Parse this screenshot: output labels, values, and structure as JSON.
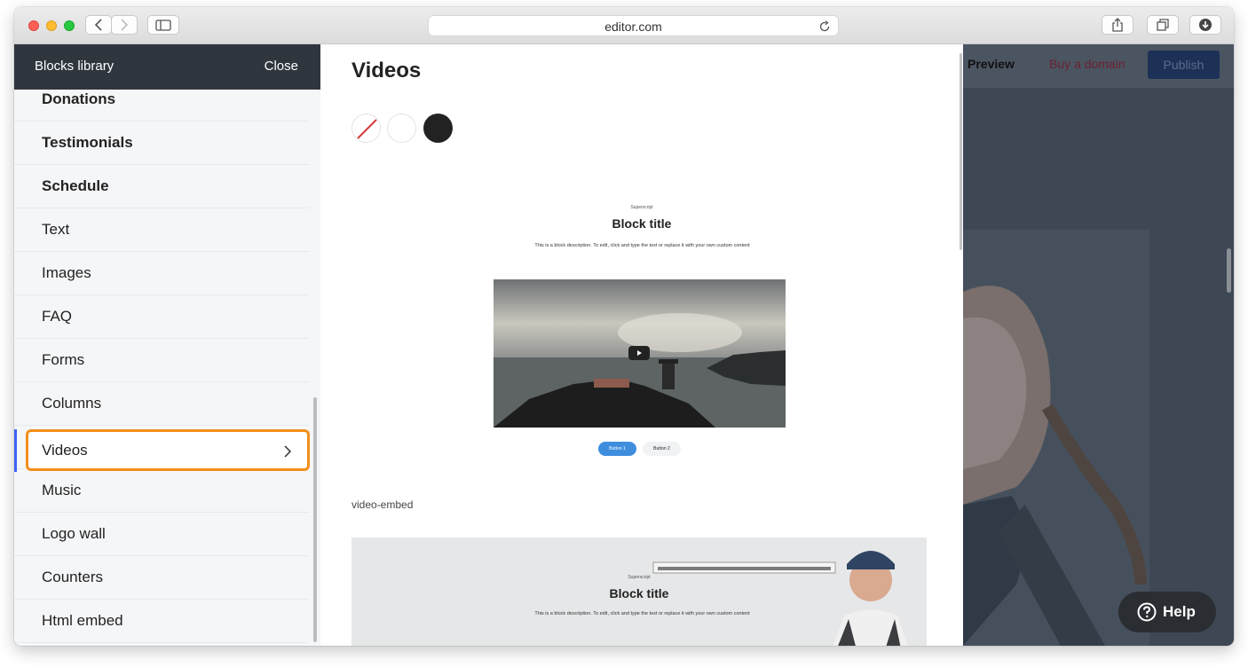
{
  "browser": {
    "url": "editor.com"
  },
  "sidebar": {
    "title": "Blocks library",
    "close_label": "Close",
    "items": [
      {
        "label": "Donations",
        "bold": true
      },
      {
        "label": "Testimonials",
        "bold": true
      },
      {
        "label": "Schedule",
        "bold": true
      },
      {
        "label": "Text",
        "bold": false
      },
      {
        "label": "Images",
        "bold": false
      },
      {
        "label": "FAQ",
        "bold": false
      },
      {
        "label": "Forms",
        "bold": false
      },
      {
        "label": "Columns",
        "bold": false
      },
      {
        "label": "Videos",
        "bold": false,
        "active": true
      },
      {
        "label": "Music",
        "bold": false
      },
      {
        "label": "Logo wall",
        "bold": false
      },
      {
        "label": "Counters",
        "bold": false
      },
      {
        "label": "Html embed",
        "bold": false
      }
    ]
  },
  "library": {
    "title": "Videos",
    "swatches": [
      "none",
      "#ffffff",
      "#222222"
    ],
    "preview1": {
      "superscript": "Superscript",
      "title": "Block title",
      "description": "This is a block description. To edit, click and type the text or replace it with your own custom content",
      "button1": "Button 1",
      "button2": "Button 2"
    },
    "caption": "video-embed",
    "preview2": {
      "superscript": "Superscript",
      "title": "Block title",
      "description": "This is a block description. To edit, click and type the text or replace it with your own custom content"
    }
  },
  "site": {
    "preview_label": "Preview",
    "domain_label": "Buy a domain",
    "publish_label": "Publish"
  },
  "help": {
    "label": "Help"
  },
  "colors": {
    "accent": "#3d63f3",
    "highlight": "#f28f1a",
    "sidebar_header": "#30363e",
    "button_primary": "#3f8ede"
  }
}
